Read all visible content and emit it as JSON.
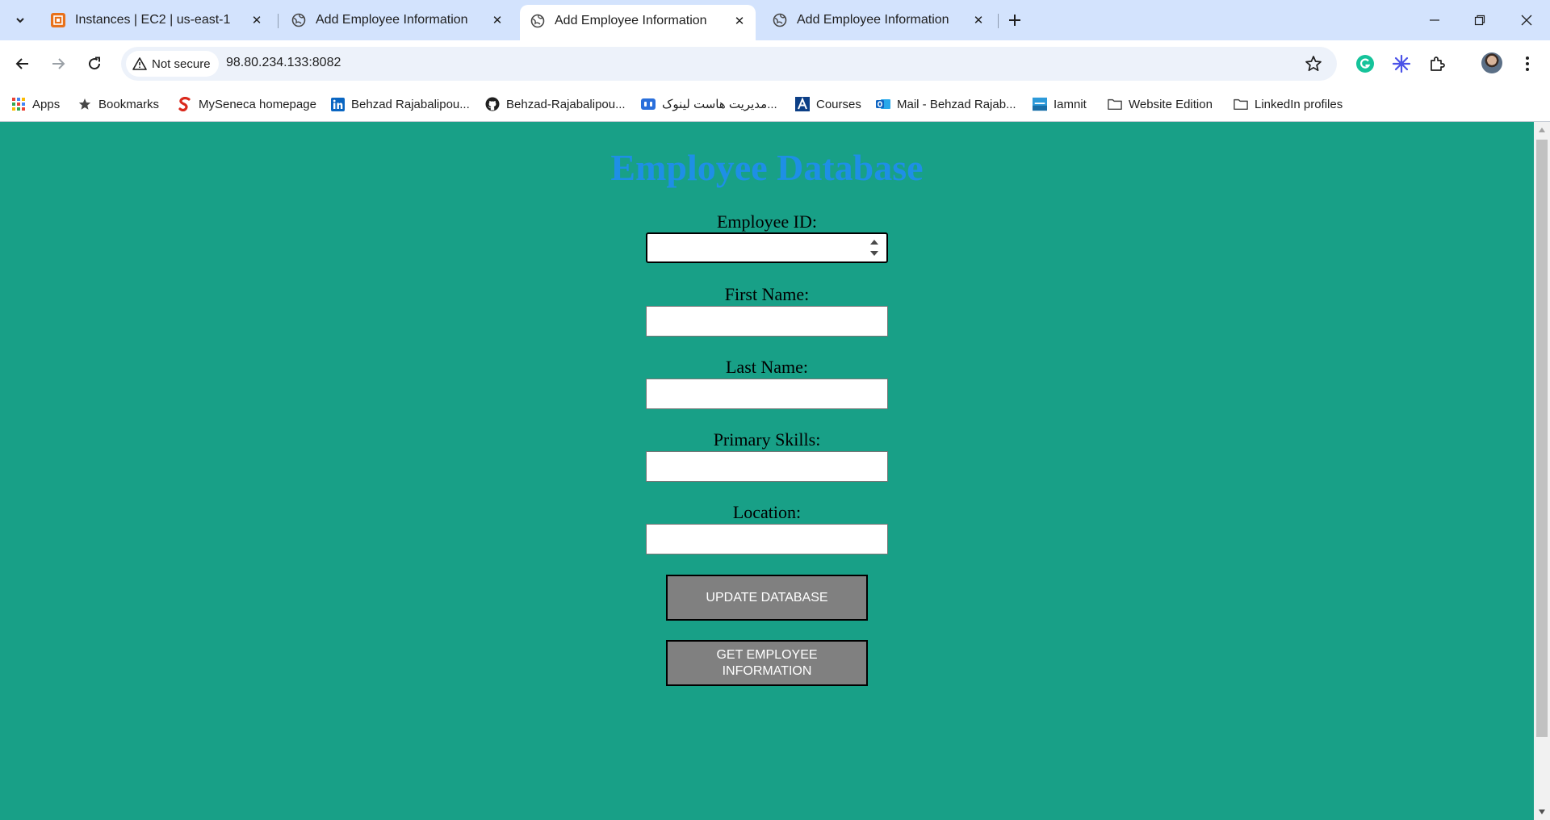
{
  "browser": {
    "tabs": [
      {
        "title": "Instances | EC2 | us-east-1",
        "icon": "aws-icon",
        "active": false
      },
      {
        "title": "Add Employee Information",
        "icon": "globe-icon",
        "active": false
      },
      {
        "title": "Add Employee Information",
        "icon": "globe-icon",
        "active": true
      },
      {
        "title": "Add Employee Information",
        "icon": "globe-icon",
        "active": false
      }
    ],
    "security_label": "Not secure",
    "url": "98.80.234.133:8082"
  },
  "bookmarks": [
    {
      "label": "Apps",
      "icon": "apps-grid-icon"
    },
    {
      "label": "Bookmarks",
      "icon": "star-icon"
    },
    {
      "label": "MySeneca homepage",
      "icon": "seneca-icon"
    },
    {
      "label": "Behzad Rajabalipou...",
      "icon": "linkedin-icon"
    },
    {
      "label": "Behzad-Rajabalipou...",
      "icon": "github-icon"
    },
    {
      "label": "مدیریت هاست لینوک...",
      "icon": "host-icon"
    },
    {
      "label": "Courses",
      "icon": "courses-icon"
    },
    {
      "label": "Mail - Behzad Rajab...",
      "icon": "outlook-icon"
    },
    {
      "label": "Iamnit",
      "icon": "iamnit-icon"
    },
    {
      "label": "Website Edition",
      "icon": "folder-icon"
    },
    {
      "label": "LinkedIn profiles",
      "icon": "folder-icon"
    }
  ],
  "page": {
    "title": "Employee Database",
    "fields": [
      {
        "label": "Employee ID:",
        "value": "",
        "type": "number"
      },
      {
        "label": "First Name:",
        "value": "",
        "type": "text"
      },
      {
        "label": "Last Name:",
        "value": "",
        "type": "text"
      },
      {
        "label": "Primary Skills:",
        "value": "",
        "type": "text"
      },
      {
        "label": "Location:",
        "value": "",
        "type": "text"
      }
    ],
    "buttons": {
      "update": "UPDATE DATABASE",
      "get_line1": "GET EMPLOYEE",
      "get_line2": "INFORMATION"
    }
  },
  "colors": {
    "page_background": "#18a087",
    "title": "#1e8fe6",
    "button": "#808080",
    "tabstrip": "#d3e3fd"
  }
}
